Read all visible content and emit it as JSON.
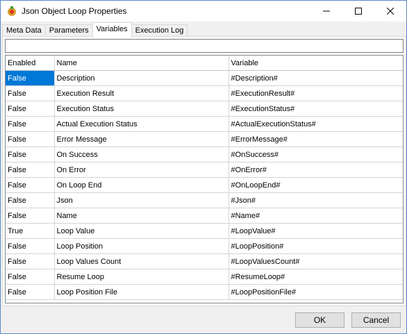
{
  "window": {
    "title": "Json Object Loop Properties"
  },
  "tabs": [
    {
      "label": "Meta Data"
    },
    {
      "label": "Parameters"
    },
    {
      "label": "Variables"
    },
    {
      "label": "Execution Log"
    }
  ],
  "filter": {
    "value": ""
  },
  "table": {
    "columns": [
      "Enabled",
      "Name",
      "Variable"
    ],
    "rows": [
      {
        "enabled": "False",
        "name": "Description",
        "variable": "#Description#"
      },
      {
        "enabled": "False",
        "name": "Execution Result",
        "variable": "#ExecutionResult#"
      },
      {
        "enabled": "False",
        "name": "Execution Status",
        "variable": "#ExecutionStatus#"
      },
      {
        "enabled": "False",
        "name": "Actual Execution Status",
        "variable": "#ActualExecutionStatus#"
      },
      {
        "enabled": "False",
        "name": "Error Message",
        "variable": "#ErrorMessage#"
      },
      {
        "enabled": "False",
        "name": "On Success",
        "variable": "#OnSuccess#"
      },
      {
        "enabled": "False",
        "name": "On Error",
        "variable": "#OnError#"
      },
      {
        "enabled": "False",
        "name": "On Loop End",
        "variable": "#OnLoopEnd#"
      },
      {
        "enabled": "False",
        "name": "Json",
        "variable": "#Json#"
      },
      {
        "enabled": "False",
        "name": "Name",
        "variable": "#Name#"
      },
      {
        "enabled": "True",
        "name": "Loop Value",
        "variable": "#LoopValue#"
      },
      {
        "enabled": "False",
        "name": "Loop Position",
        "variable": "#LoopPosition#"
      },
      {
        "enabled": "False",
        "name": "Loop Values Count",
        "variable": "#LoopValuesCount#"
      },
      {
        "enabled": "False",
        "name": "Resume Loop",
        "variable": "#ResumeLoop#"
      },
      {
        "enabled": "False",
        "name": "Loop Position File",
        "variable": "#LoopPositionFile#"
      }
    ]
  },
  "buttons": {
    "ok": "OK",
    "cancel": "Cancel"
  },
  "icons": {
    "app": "app-gear-icon",
    "minimize": "minimize-icon",
    "maximize": "maximize-icon",
    "close": "close-icon"
  },
  "colors": {
    "selection": "#0078d7",
    "border": "#5a86c9"
  }
}
